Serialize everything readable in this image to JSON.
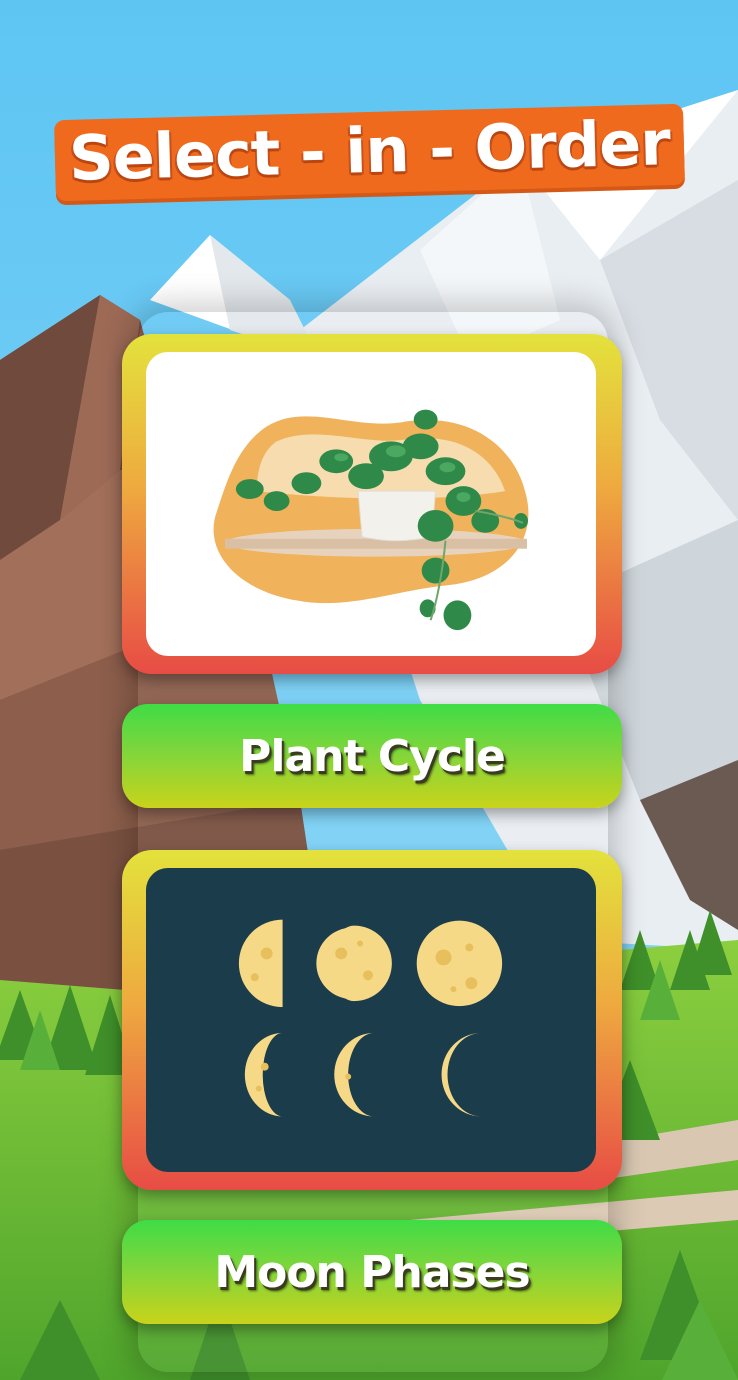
{
  "title": "Select - in - Order",
  "options": [
    {
      "image": "plant-image",
      "label": "Plant Cycle"
    },
    {
      "image": "moon-phases-image",
      "label": "Moon Phases"
    }
  ],
  "colors": {
    "sky": "#5ec5f3",
    "title_bg": "#ef6a1c",
    "card_top": "#e3e23c",
    "card_bottom": "#e84c45",
    "button_top": "#3fdc46",
    "button_bottom": "#c9d31b",
    "moon_bg": "#1b3c4b",
    "moon": "#f6d986"
  }
}
